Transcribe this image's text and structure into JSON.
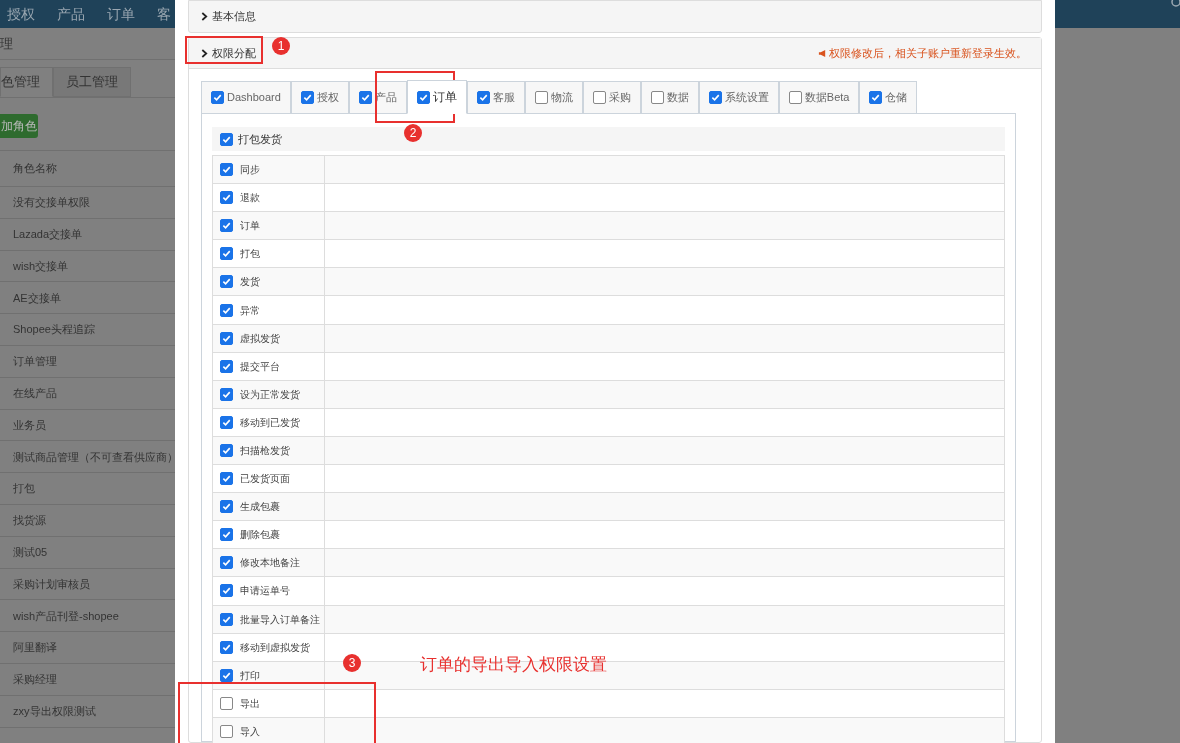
{
  "background": {
    "nav": [
      "授权",
      "产品",
      "订单",
      "客"
    ],
    "breadcrumb": "理",
    "tabs": [
      {
        "label": "色管理",
        "selected": true
      },
      {
        "label": "员工管理",
        "selected": false
      }
    ],
    "add_button": "加角色",
    "table": {
      "column_header": "角色名称",
      "rows": [
        "没有交接单权限",
        "Lazada交接单",
        "wish交接单",
        "AE交接单",
        "Shopee头程追踪",
        "订单管理",
        "在线产品",
        "业务员",
        "测试商品管理（不可查看供应商）",
        "打包",
        "找货源",
        "测试05",
        "采购计划审核员",
        "wish产品刊登-shopee",
        "阿里翻译",
        "采购经理",
        "zxy导出权限测试"
      ]
    }
  },
  "modal": {
    "panels": [
      {
        "title": "基本信息"
      },
      {
        "title": "权限分配",
        "notice": "权限修改后，相关子账户重新登录生效。"
      }
    ],
    "tabs": [
      {
        "label": "Dashboard",
        "checked": true,
        "selected": false
      },
      {
        "label": "授权",
        "checked": true,
        "selected": false
      },
      {
        "label": "产品",
        "checked": true,
        "selected": false
      },
      {
        "label": "订单",
        "checked": true,
        "selected": true
      },
      {
        "label": "客服",
        "checked": true,
        "selected": false
      },
      {
        "label": "物流",
        "checked": false,
        "selected": false
      },
      {
        "label": "采购",
        "checked": false,
        "selected": false
      },
      {
        "label": "数据",
        "checked": false,
        "selected": false
      },
      {
        "label": "系统设置",
        "checked": true,
        "selected": false
      },
      {
        "label": "数据Beta",
        "checked": false,
        "selected": false
      },
      {
        "label": "仓储",
        "checked": true,
        "selected": false
      }
    ],
    "group": {
      "label": "打包发货",
      "checked": true
    },
    "permissions": [
      {
        "label": "同步",
        "checked": true
      },
      {
        "label": "退款",
        "checked": true
      },
      {
        "label": "订单",
        "checked": true
      },
      {
        "label": "打包",
        "checked": true
      },
      {
        "label": "发货",
        "checked": true
      },
      {
        "label": "异常",
        "checked": true
      },
      {
        "label": "虚拟发货",
        "checked": true
      },
      {
        "label": "提交平台",
        "checked": true
      },
      {
        "label": "设为正常发货",
        "checked": true
      },
      {
        "label": "移动到已发货",
        "checked": true
      },
      {
        "label": "扫描枪发货",
        "checked": true
      },
      {
        "label": "已发货页面",
        "checked": true
      },
      {
        "label": "生成包裹",
        "checked": true
      },
      {
        "label": "删除包裹",
        "checked": true
      },
      {
        "label": "修改本地备注",
        "checked": true
      },
      {
        "label": "申请运单号",
        "checked": true
      },
      {
        "label": "批量导入订单备注",
        "checked": true
      },
      {
        "label": "移动到虚拟发货",
        "checked": true
      },
      {
        "label": "打印",
        "checked": true
      },
      {
        "label": "导出",
        "checked": false
      },
      {
        "label": "导入",
        "checked": false
      }
    ]
  },
  "annotations": {
    "markers": [
      "1",
      "2",
      "3"
    ],
    "note": "订单的导出导入权限设置"
  }
}
